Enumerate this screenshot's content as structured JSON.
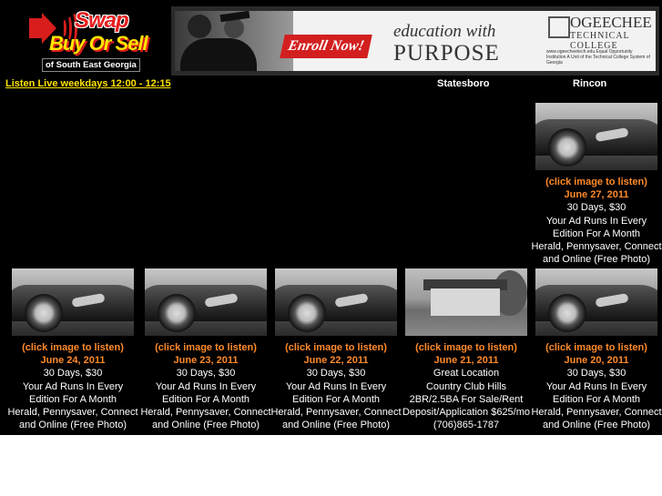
{
  "logo": {
    "line1": "Swap",
    "line2": "Buy Or Sell",
    "line3": "of South East Georgia"
  },
  "banner": {
    "enroll": "Enroll Now!",
    "education": "education with",
    "purpose": "PURPOSE",
    "college_name": "OGEECHEE",
    "college_sub": "TECHNICAL COLLEGE",
    "fine_print": "www.ogeecheetech.edu Equal Opportunity Institution A Unit of the Technical College System of Georgia"
  },
  "nav": {
    "listen_live": "Listen Live weekdays 12:00 - 12:15",
    "statesboro": "Statesboro",
    "rincon": "Rincon"
  },
  "ads": [
    {
      "photo": "car",
      "click": "(click image to listen)",
      "date": "June 27, 2011",
      "lines": [
        "30 Days, $30",
        "Your Ad Runs In Every",
        "Edition For A Month",
        "Herald, Pennysaver, Connect",
        "and Online (Free Photo)"
      ]
    },
    {
      "photo": "car",
      "click": "(click image to listen)",
      "date": "June 24, 2011",
      "lines": [
        "30 Days, $30",
        "Your Ad Runs In Every",
        "Edition For A Month",
        "Herald, Pennysaver, Connect",
        "and Online (Free Photo)"
      ]
    },
    {
      "photo": "car",
      "click": "(click image to listen)",
      "date": "June 23, 2011",
      "lines": [
        "30 Days, $30",
        "Your Ad Runs In Every",
        "Edition For A Month",
        "Herald, Pennysaver, Connect",
        "and Online (Free Photo)"
      ]
    },
    {
      "photo": "car",
      "click": "(click image to listen)",
      "date": "June 22, 2011",
      "lines": [
        "30 Days, $30",
        "Your Ad Runs In Every",
        "Edition For A Month",
        "Herald, Pennysaver, Connect",
        "and Online (Free Photo)"
      ]
    },
    {
      "photo": "house",
      "click": "(click image to listen)",
      "date": "June 21, 2011",
      "lines": [
        "Great Location",
        "Country Club Hills",
        "2BR/2.5BA For Sale/Rent",
        "Deposit/Application $625/mo",
        "(706)865-1787"
      ]
    },
    {
      "photo": "car",
      "click": "(click image to listen)",
      "date": "June 20, 2011",
      "lines": [
        "30 Days, $30",
        "Your Ad Runs In Every",
        "Edition For A Month",
        "Herald, Pennysaver, Connect",
        "and Online (Free Photo)"
      ]
    }
  ]
}
